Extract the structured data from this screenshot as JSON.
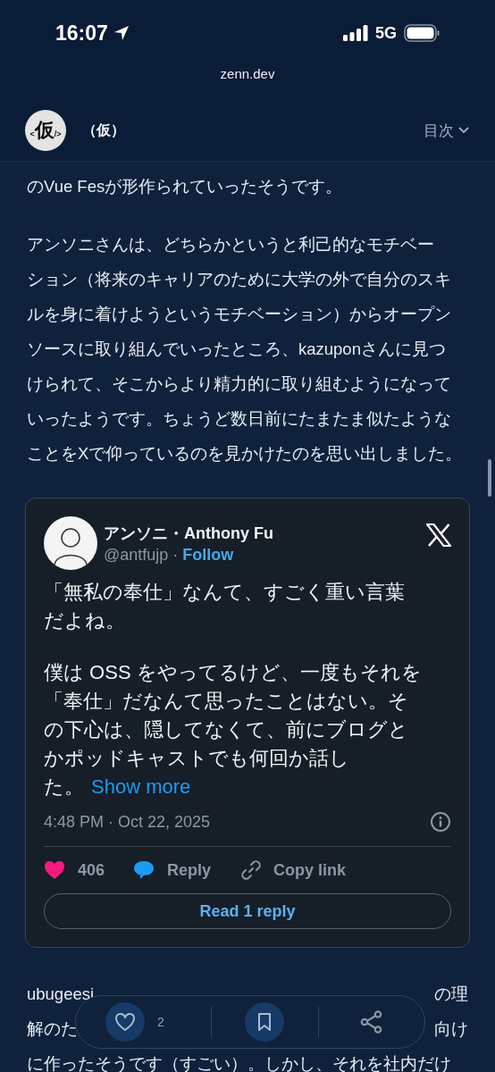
{
  "status_bar": {
    "time": "16:07",
    "network": "5G"
  },
  "browser": {
    "url": "zenn.dev"
  },
  "site_header": {
    "logo": {
      "left": "<",
      "main": "仮",
      "right": "/>"
    },
    "title": "（仮）",
    "toc_label": "目次"
  },
  "article": {
    "paragraphs_before": [
      {
        "lines": [
          "のVue Fesが形作られていったそうです。"
        ]
      },
      {
        "lines": [
          "アンソニさんは、どちらかというと利己的なモチベー",
          "ション（将来のキャリアのために大学の外で自分のスキ",
          "ルを身に着けようというモチベーション）からオープン",
          "ソースに取り組んでいったところ、kazuponさんに見つ",
          "けられて、そこからより精力的に取り組むようになって",
          "いったようです。ちょうど数日前にたまたま似たような",
          "ことをXで仰っているのを見かけたのを思い出しました。"
        ]
      }
    ],
    "tweet": {
      "name": "アンソニ・Anthony Fu",
      "handle": "@antfujp",
      "separator": "·",
      "follow": "Follow",
      "paragraphs": [
        {
          "lines": [
            "「無私の奉仕」なんて、すごく重い言葉",
            "だよね。"
          ]
        },
        {
          "lines": [
            "僕は OSS をやってるけど、一度もそれを",
            "「奉仕」だなんて思ったことはない。そ",
            "の下心は、隠してなくて、前にブログと",
            "かポッドキャストでも何回か話し",
            "た。"
          ]
        }
      ],
      "show_more": "Show more",
      "timestamp": "4:48 PM · Oct 22, 2025",
      "likes": "406",
      "reply": "Reply",
      "copy_link": "Copy link",
      "read_replies": "Read 1 reply"
    },
    "paragraph_after": {
      "line_1_start": "ubugeesi",
      "line_1_end": "の理",
      "line_2_start": "解のた",
      "line_2_end": "向け",
      "line_3": "に作ったそうです（すごい）。しかし、それを社内だけ"
    }
  },
  "action_bar": {
    "like_count": "2"
  }
}
